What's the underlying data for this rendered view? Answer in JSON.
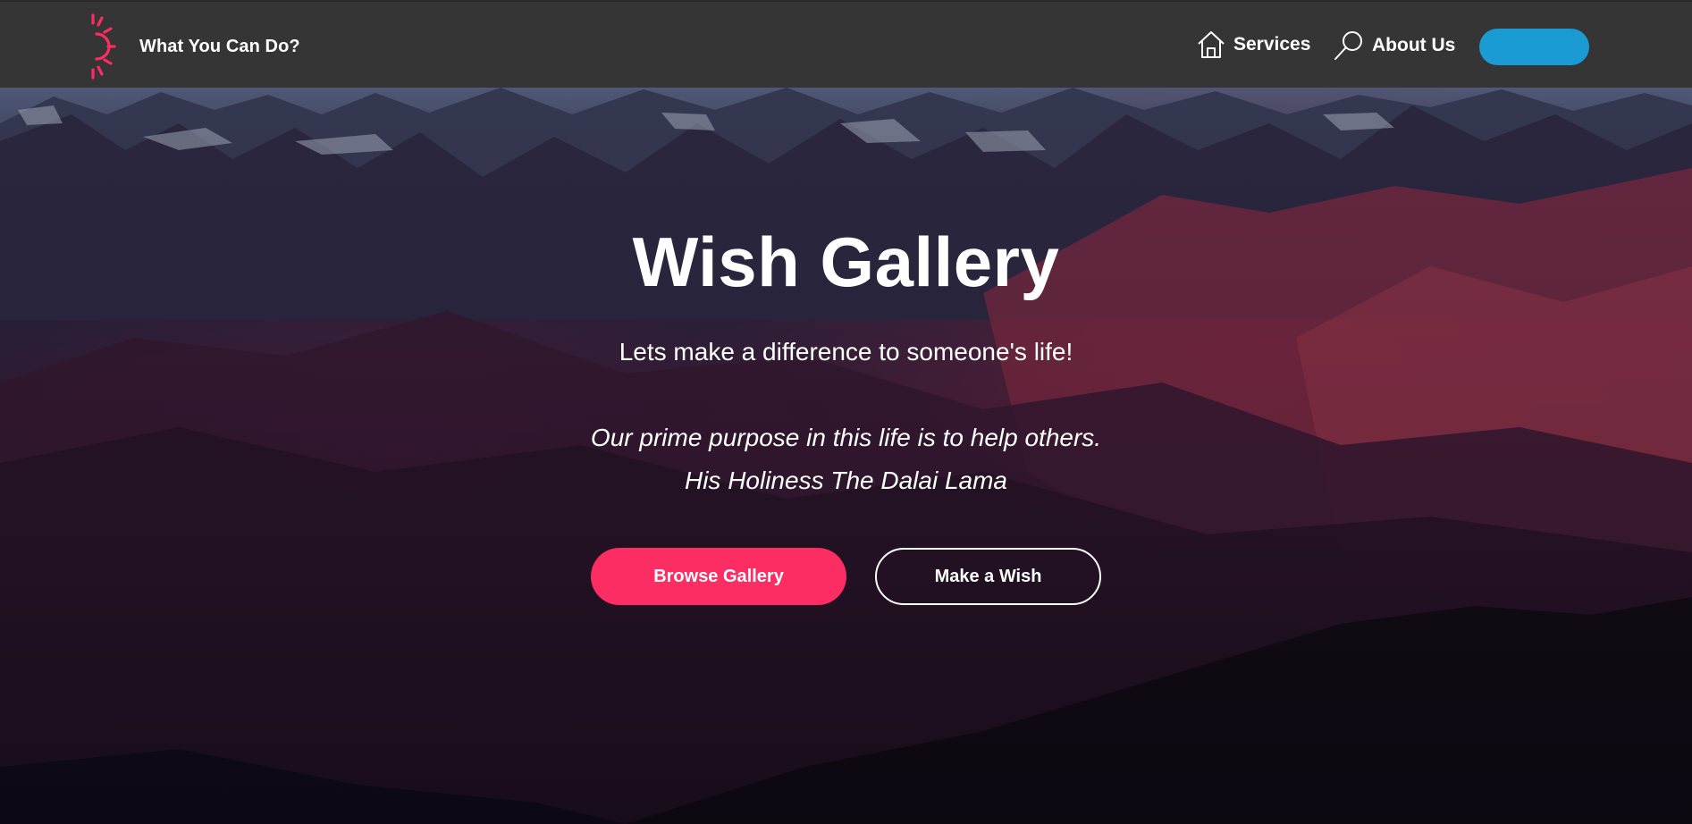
{
  "navbar": {
    "brand": "What You Can Do?",
    "links": [
      {
        "label": "Services",
        "icon": "home-icon"
      },
      {
        "label": "About Us",
        "icon": "search-icon"
      }
    ],
    "cta_label": ""
  },
  "hero": {
    "title": "Wish Gallery",
    "subtitle": "Lets make a difference to someone's life!",
    "quote": "Our prime purpose in this life is to help others.",
    "author": "His Holiness The Dalai Lama",
    "primary_button": "Browse Gallery",
    "secondary_button": "Make a Wish"
  },
  "colors": {
    "navbar_bg": "#353535",
    "logo": "#fb2d62",
    "cta": "#1a9bd3",
    "primary_button": "#fb2d62",
    "text": "#ffffff"
  }
}
